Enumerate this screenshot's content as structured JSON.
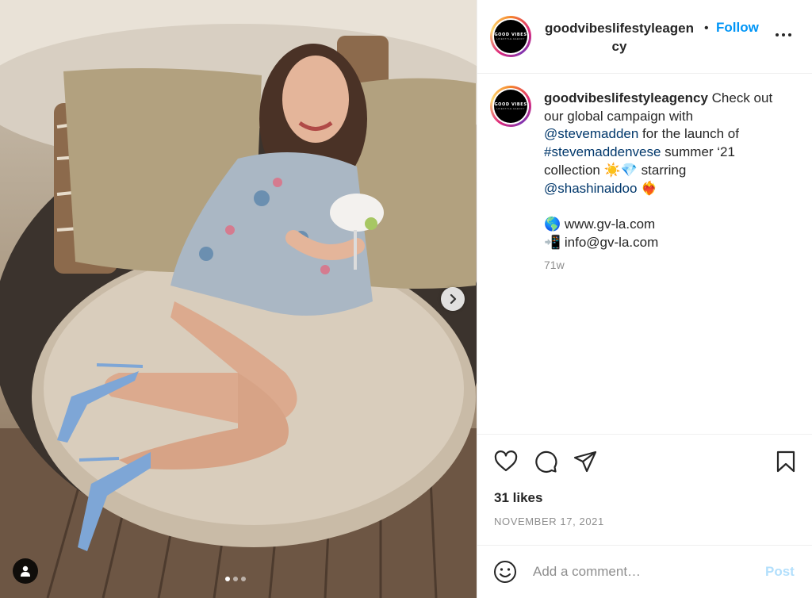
{
  "media": {
    "carousel_total": 3,
    "carousel_active_index": 0,
    "logo_text": "GOOD VIBES",
    "logo_subtext": "LIFESTYLE AGENCY"
  },
  "header": {
    "username": "goodvibeslifestyleagency",
    "separator": "•",
    "follow_label": "Follow"
  },
  "caption": {
    "username": "goodvibeslifestyleagency",
    "text_1": " Check out our global campaign with ",
    "mention_1": "@stevemadden",
    "text_2": " for the launch of ",
    "hashtag": "#stevemaddenvese",
    "text_3": " summer ‘21 collection ☀️💎 starring ",
    "mention_2": "@shashinaidoo",
    "text_4": " ❤️‍🔥",
    "website_line": "🌎 www.gv-la.com",
    "email_line": "📲 info@gv-la.com",
    "time_ago": "71w"
  },
  "actions": {
    "likes": "31 likes",
    "date": "NOVEMBER 17, 2021"
  },
  "comment": {
    "placeholder": "Add a comment…",
    "post_label": "Post"
  },
  "colors": {
    "link_blue": "#0095f6",
    "mention_blue": "#00376b",
    "muted": "#8e8e8e",
    "post_disabled": "#b2dffc"
  },
  "icons": [
    "user-tag-icon",
    "chevron-right-icon",
    "more-options-icon",
    "heart-icon",
    "comment-icon",
    "share-icon",
    "bookmark-icon",
    "emoji-icon"
  ]
}
